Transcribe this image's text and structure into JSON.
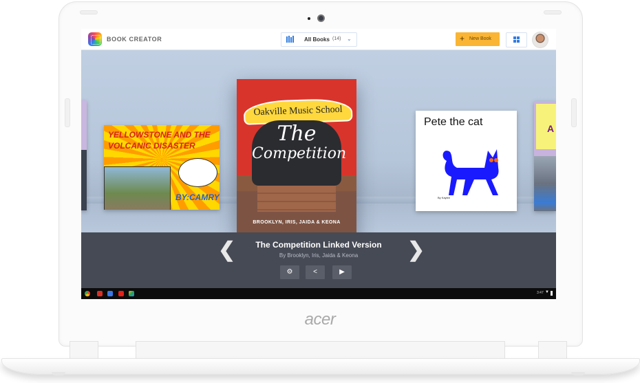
{
  "device": {
    "brand_label": "acer"
  },
  "app": {
    "title": "BOOK CREATOR"
  },
  "toolbar": {
    "filter_label": "All Books",
    "filter_count": "(14)",
    "new_book_label": "New Book",
    "icons": {
      "library": "library-icon",
      "chevron": "chevron-down-icon",
      "plus": "plus-icon",
      "grid": "grid-view-icon",
      "avatar": "user-avatar"
    }
  },
  "shelf": {
    "books": [
      {
        "id": "left-partial",
        "title": ""
      },
      {
        "id": "yellowstone",
        "title": "YELLOWSTONE AND THE VOLCANIC DISASTER",
        "byline": "BY:CAMRYN"
      },
      {
        "id": "competition",
        "banner": "Oakville Music School",
        "title_line1": "The",
        "title_line2": "Competition",
        "authors": "BROOKLYN, IRIS, JAIDA & KEONA"
      },
      {
        "id": "pete",
        "title": "Pete the cat",
        "byline": "By Kaylee"
      },
      {
        "id": "right-partial",
        "letter": "A"
      }
    ]
  },
  "selected_book": {
    "title": "The Competition Linked Version",
    "byline": "By Brooklyn, Iris, Jaida & Keona",
    "prev_glyph": "❮",
    "next_glyph": "❯",
    "actions": [
      {
        "name": "settings",
        "glyph": "⚙"
      },
      {
        "name": "share",
        "glyph": "<"
      },
      {
        "name": "play",
        "glyph": "▶"
      }
    ]
  },
  "taskbar": {
    "apps": [
      {
        "name": "chrome",
        "color": "#e8453c"
      },
      {
        "name": "gmail",
        "color": "#d93025"
      },
      {
        "name": "google-search",
        "color": "#3b78e7"
      },
      {
        "name": "youtube",
        "color": "#e62117"
      },
      {
        "name": "drive",
        "color": "#1fa463"
      }
    ],
    "clock": "3:47",
    "wifi_glyph": "▼"
  },
  "colors": {
    "accent_blue": "#2f7be0",
    "new_book_orange": "#f9b533",
    "info_bar": "#464a55",
    "shelf_bg": "#bccbde"
  }
}
